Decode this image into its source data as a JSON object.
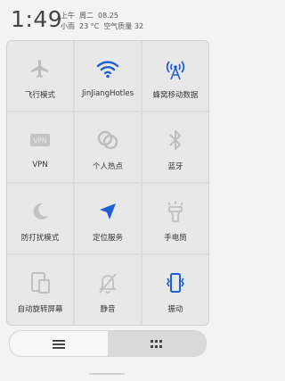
{
  "status": {
    "time": "1:49",
    "ampm": "上午",
    "weekday": "周二",
    "date": "08.25",
    "weather": "小雨",
    "temperature": "23 °C",
    "air_quality": "空气质量 32"
  },
  "colors": {
    "active": "#1f5fd6",
    "inactive": "#bdbdbd"
  },
  "toggles": [
    {
      "label": "飞行模式",
      "icon": "airplane-icon",
      "active": false
    },
    {
      "label": "JinJiangHotles",
      "icon": "wifi-icon",
      "active": true
    },
    {
      "label": "蜂窝移动数据",
      "icon": "cellular-tower-icon",
      "active": true
    },
    {
      "label": "VPN",
      "icon": "vpn-icon",
      "active": false
    },
    {
      "label": "个人热点",
      "icon": "hotspot-icon",
      "active": false
    },
    {
      "label": "蓝牙",
      "icon": "bluetooth-icon",
      "active": false
    },
    {
      "label": "防打扰模式",
      "icon": "moon-icon",
      "active": false
    },
    {
      "label": "定位服务",
      "icon": "location-arrow-icon",
      "active": true
    },
    {
      "label": "手电筒",
      "icon": "flashlight-icon",
      "active": false
    },
    {
      "label": "自动旋转屏幕",
      "icon": "rotate-screen-icon",
      "active": false
    },
    {
      "label": "静音",
      "icon": "mute-bell-icon",
      "active": false
    },
    {
      "label": "振动",
      "icon": "vibrate-icon",
      "active": true
    }
  ],
  "bottom_bar": {
    "left_icon": "menu-icon",
    "right_icon": "grid-icon",
    "selected": "right"
  }
}
